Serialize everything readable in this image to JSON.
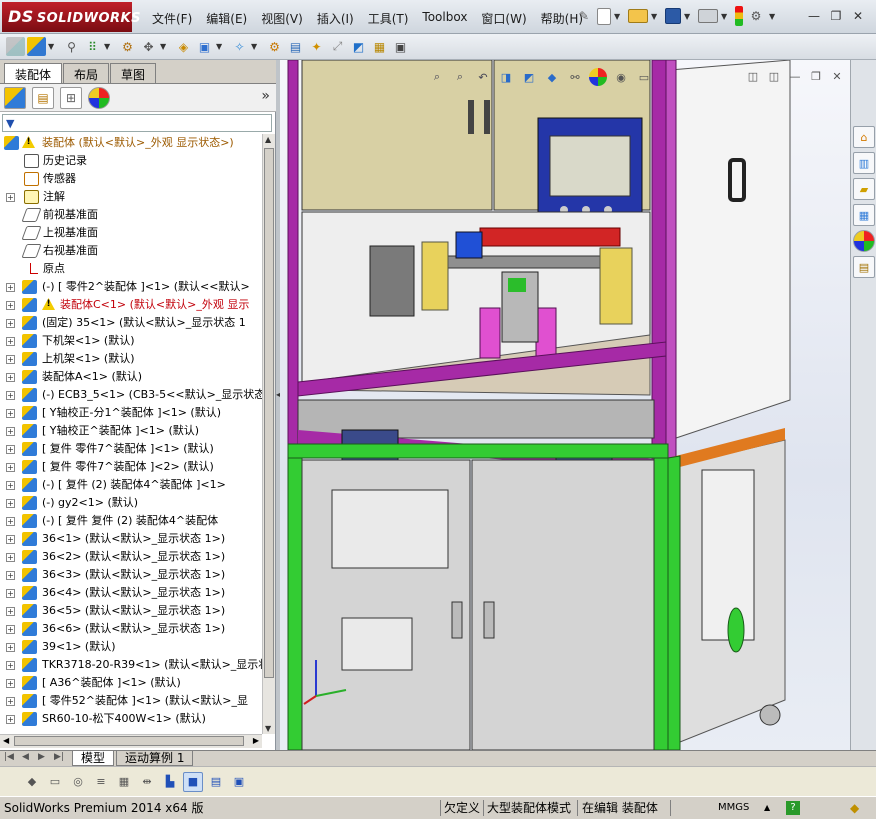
{
  "app": {
    "brand": "SOLIDWORKS",
    "brand_prefix": "DS"
  },
  "menu": [
    "文件(F)",
    "编辑(E)",
    "视图(V)",
    "插入(I)",
    "工具(T)",
    "Toolbox",
    "窗口(W)",
    "帮助(H)"
  ],
  "panel_tabs": [
    "装配体",
    "布局",
    "草图"
  ],
  "tree": {
    "root": "装配体  (默认<默认>_外观 显示状态>)",
    "items": [
      {
        "label": "历史记录",
        "icon": "history-icon",
        "expand": false,
        "type": "hist"
      },
      {
        "label": "传感器",
        "icon": "sensor-icon",
        "expand": false,
        "type": "sensor"
      },
      {
        "label": "注解",
        "icon": "annotation-icon",
        "expand": true,
        "type": "note"
      },
      {
        "label": "前视基准面",
        "icon": "plane-icon",
        "expand": false,
        "type": "plane"
      },
      {
        "label": "上视基准面",
        "icon": "plane-icon",
        "expand": false,
        "type": "plane"
      },
      {
        "label": "右视基准面",
        "icon": "plane-icon",
        "expand": false,
        "type": "plane"
      },
      {
        "label": "原点",
        "icon": "origin-icon",
        "expand": false,
        "type": "origin"
      },
      {
        "label": "(-) [ 零件2^装配体 ]<1> (默认<<默认>",
        "icon": "assembly-icon",
        "expand": true,
        "type": "asm"
      },
      {
        "label": "装配体C<1> (默认<默认>_外观 显示",
        "icon": "assembly-icon",
        "expand": true,
        "type": "asm",
        "warn": true,
        "red": true
      },
      {
        "label": "(固定) 35<1> (默认<默认>_显示状态 1",
        "icon": "assembly-icon",
        "expand": true,
        "type": "asm"
      },
      {
        "label": "下机架<1> (默认)",
        "icon": "assembly-icon",
        "expand": true,
        "type": "asm"
      },
      {
        "label": "上机架<1> (默认)",
        "icon": "assembly-icon",
        "expand": true,
        "type": "asm"
      },
      {
        "label": "装配体A<1> (默认)",
        "icon": "assembly-icon",
        "expand": true,
        "type": "asm"
      },
      {
        "label": "(-) ECB3_5<1> (CB3-5<<默认>_显示状态",
        "icon": "assembly-icon",
        "expand": true,
        "type": "asm"
      },
      {
        "label": "[ Y轴校正-分1^装配体 ]<1> (默认)",
        "icon": "assembly-icon",
        "expand": true,
        "type": "asm"
      },
      {
        "label": "[ Y轴校正^装配体 ]<1> (默认)",
        "icon": "assembly-icon",
        "expand": true,
        "type": "asm"
      },
      {
        "label": "[ 复件 零件7^装配体 ]<1> (默认)",
        "icon": "assembly-icon",
        "expand": true,
        "type": "asm"
      },
      {
        "label": "[ 复件 零件7^装配体 ]<2> (默认)",
        "icon": "assembly-icon",
        "expand": true,
        "type": "asm"
      },
      {
        "label": "(-) [ 复件 (2) 装配体4^装配体 ]<1>",
        "icon": "assembly-icon",
        "expand": true,
        "type": "asm"
      },
      {
        "label": "(-) gy2<1> (默认)",
        "icon": "assembly-icon",
        "expand": true,
        "type": "asm"
      },
      {
        "label": "(-) [ 复件 复件 (2) 装配体4^装配体",
        "icon": "assembly-icon",
        "expand": true,
        "type": "asm"
      },
      {
        "label": "36<1> (默认<默认>_显示状态 1>)",
        "icon": "assembly-icon",
        "expand": true,
        "type": "asm"
      },
      {
        "label": "36<2> (默认<默认>_显示状态 1>)",
        "icon": "assembly-icon",
        "expand": true,
        "type": "asm"
      },
      {
        "label": "36<3> (默认<默认>_显示状态 1>)",
        "icon": "assembly-icon",
        "expand": true,
        "type": "asm"
      },
      {
        "label": "36<4> (默认<默认>_显示状态 1>)",
        "icon": "assembly-icon",
        "expand": true,
        "type": "asm"
      },
      {
        "label": "36<5> (默认<默认>_显示状态 1>)",
        "icon": "assembly-icon",
        "expand": true,
        "type": "asm"
      },
      {
        "label": "36<6> (默认<默认>_显示状态 1>)",
        "icon": "assembly-icon",
        "expand": true,
        "type": "asm"
      },
      {
        "label": "39<1> (默认)",
        "icon": "assembly-icon",
        "expand": true,
        "type": "asm"
      },
      {
        "label": "TKR3718-20-R39<1> (默认<默认>_显示状",
        "icon": "assembly-icon",
        "expand": true,
        "type": "asm"
      },
      {
        "label": "[ A36^装配体 ]<1> (默认)",
        "icon": "assembly-icon",
        "expand": true,
        "type": "asm"
      },
      {
        "label": "[ 零件52^装配体 ]<1> (默认<默认>_显",
        "icon": "assembly-icon",
        "expand": true,
        "type": "asm"
      },
      {
        "label": "SR60-10-松下400W<1> (默认)",
        "icon": "assembly-icon",
        "expand": true,
        "type": "asm"
      }
    ]
  },
  "bottom_tabs": [
    "模型",
    "运动算例 1"
  ],
  "status": {
    "product": "SolidWorks Premium 2014 x64 版",
    "underdefined": "欠定义",
    "large_mode": "大型装配体模式",
    "editing": "在编辑 装配体",
    "units": "MMGS"
  },
  "colors": {
    "frame_green": "#33cc33",
    "frame_purple": "#a62aa6",
    "cabinet_gray": "#d8d8d8",
    "upper_olive": "#d8d0a4"
  }
}
